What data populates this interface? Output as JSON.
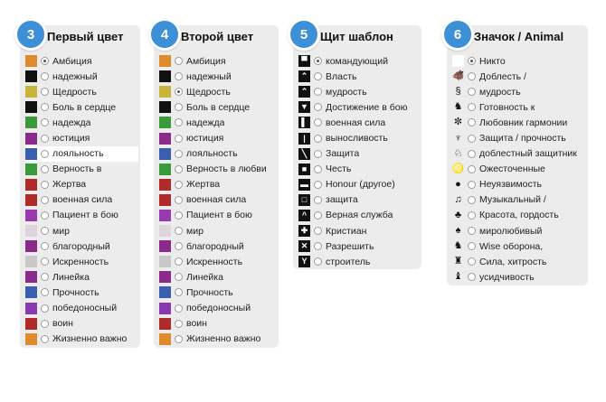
{
  "panels": [
    {
      "number": "3",
      "title": "Первый цвет",
      "selected": 0,
      "items": [
        {
          "label": "Амбиция",
          "color": "#e08a2e"
        },
        {
          "label": "надежный",
          "color": "#111111"
        },
        {
          "label": "Щедрость",
          "color": "#c8b43a"
        },
        {
          "label": "Боль в сердце",
          "color": "#111111"
        },
        {
          "label": "надежда",
          "color": "#3a9a3a"
        },
        {
          "label": "юстиция",
          "color": "#8a2a8a"
        },
        {
          "label": "лояльность",
          "color": "#3a5fb0"
        },
        {
          "label": "Верность в",
          "color": "#3a9a3a"
        },
        {
          "label": "Жертва",
          "color": "#b02a2a"
        },
        {
          "label": "военная сила",
          "color": "#b02a2a"
        },
        {
          "label": "Пациент в бою",
          "color": "#9a3ab0"
        },
        {
          "label": "мир",
          "color": "#ddd4dc"
        },
        {
          "label": "благородный",
          "color": "#8a2a8a"
        },
        {
          "label": "Искренность",
          "color": "#c8c8c8"
        },
        {
          "label": "Линейка",
          "color": "#8a2a8a"
        },
        {
          "label": "Прочность",
          "color": "#3a5fb0"
        },
        {
          "label": "победоносный",
          "color": "#8a3ab0"
        },
        {
          "label": "воин",
          "color": "#b02a2a"
        },
        {
          "label": "Жизненно важно",
          "color": "#e08a2e"
        }
      ]
    },
    {
      "number": "4",
      "title": "Второй цвет",
      "selected": 2,
      "items": [
        {
          "label": "Амбиция",
          "color": "#e08a2e"
        },
        {
          "label": "надежный",
          "color": "#111111"
        },
        {
          "label": "Щедрость",
          "color": "#c8b43a"
        },
        {
          "label": "Боль в сердце",
          "color": "#111111"
        },
        {
          "label": "надежда",
          "color": "#3a9a3a"
        },
        {
          "label": "юстиция",
          "color": "#8a2a8a"
        },
        {
          "label": "лояльность",
          "color": "#3a5fb0"
        },
        {
          "label": "Верность в любви",
          "color": "#3a9a3a"
        },
        {
          "label": "Жертва",
          "color": "#b02a2a"
        },
        {
          "label": "военная сила",
          "color": "#b02a2a"
        },
        {
          "label": "Пациент в бою",
          "color": "#9a3ab0"
        },
        {
          "label": "мир",
          "color": "#ddd4dc"
        },
        {
          "label": "благородный",
          "color": "#8a2a8a"
        },
        {
          "label": "Искренность",
          "color": "#c8c8c8"
        },
        {
          "label": "Линейка",
          "color": "#8a2a8a"
        },
        {
          "label": "Прочность",
          "color": "#3a5fb0"
        },
        {
          "label": "победоносный",
          "color": "#8a3ab0"
        },
        {
          "label": "воин",
          "color": "#b02a2a"
        },
        {
          "label": "Жизненно важно",
          "color": "#e08a2e"
        }
      ]
    },
    {
      "number": "5",
      "title": "Щит шаблон",
      "selected": 0,
      "items": [
        {
          "label": "командующий",
          "icon": "chief-shield-icon"
        },
        {
          "label": "Власть",
          "icon": "chevron-shield-icon"
        },
        {
          "label": "мудрость",
          "icon": "chevron-inverted-shield-icon"
        },
        {
          "label": "Достижение в бою",
          "icon": "pile-shield-icon"
        },
        {
          "label": "военная сила",
          "icon": "pale-shield-icon"
        },
        {
          "label": "выносливость",
          "icon": "pale-narrow-shield-icon"
        },
        {
          "label": "Защита",
          "icon": "bend-shield-icon"
        },
        {
          "label": "Честь",
          "icon": "inescutcheon-shield-icon"
        },
        {
          "label": "Honour (другое)",
          "icon": "fess-shield-icon"
        },
        {
          "label": "защита",
          "icon": "bordure-shield-icon"
        },
        {
          "label": "Верная служба",
          "icon": "chevronel-shield-icon"
        },
        {
          "label": "Кристиан",
          "icon": "cross-shield-icon"
        },
        {
          "label": "Разрешить",
          "icon": "saltire-shield-icon"
        },
        {
          "label": "строитель",
          "icon": "pall-shield-icon"
        }
      ]
    },
    {
      "number": "6",
      "title": "Значок / Animal",
      "selected": 0,
      "items": [
        {
          "label": "Никто",
          "icon": "none-icon"
        },
        {
          "label": "Доблесть /",
          "icon": "boar-icon"
        },
        {
          "label": "мудрость",
          "icon": "snake-icon"
        },
        {
          "label": "Готовность к",
          "icon": "rooster-icon"
        },
        {
          "label": "Любовник гармонии",
          "icon": "bee-icon"
        },
        {
          "label": "Защита / прочность",
          "icon": "double-eagle-icon"
        },
        {
          "label": "доблестный защитник",
          "icon": "dragon-icon"
        },
        {
          "label": "Ожесточенные",
          "icon": "lion-icon"
        },
        {
          "label": "Неуязвимость",
          "icon": "turtle-icon"
        },
        {
          "label": "Музыкальный /",
          "icon": "swan-icon"
        },
        {
          "label": "Красота, гордость",
          "icon": "rabbit-icon"
        },
        {
          "label": "миролюбивый",
          "icon": "dog-icon"
        },
        {
          "label": "Wise оборона,",
          "icon": "fox-icon"
        },
        {
          "label": "Сила, хитрость",
          "icon": "bear-icon"
        },
        {
          "label": "усидчивость",
          "icon": "wolf-icon"
        }
      ]
    }
  ]
}
